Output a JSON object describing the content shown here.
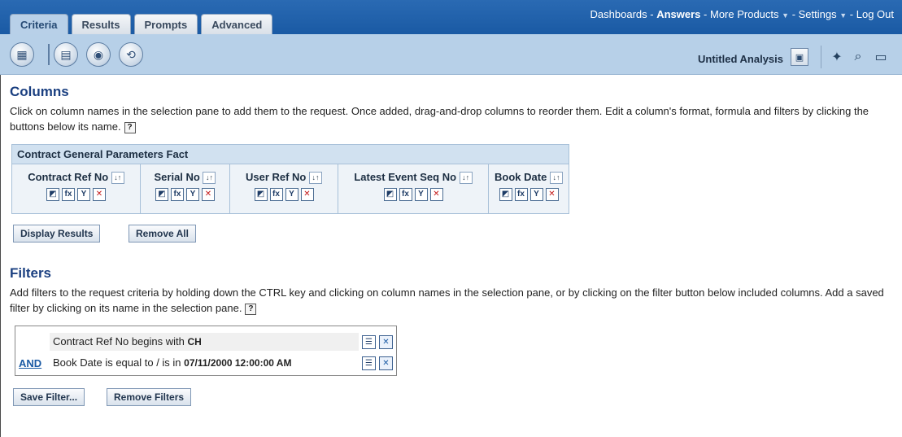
{
  "tabs": [
    {
      "label": "Criteria"
    },
    {
      "label": "Results"
    },
    {
      "label": "Prompts"
    },
    {
      "label": "Advanced"
    }
  ],
  "global_nav": {
    "dashboards": "Dashboards",
    "answers": "Answers",
    "more_products": "More Products",
    "settings": "Settings",
    "logout": "Log Out",
    "separator": " - "
  },
  "toolbar": {
    "analysis_title": "Untitled Analysis",
    "icons": [
      "chart-icon",
      "table-view-icon",
      "disk-icon",
      "refresh-icon",
      "preview-icon",
      "new-icon",
      "open-icon",
      "save-icon"
    ]
  },
  "columns": {
    "title": "Columns",
    "description": "Click on column names in the selection pane to add them to the request. Once added, drag-and-drop columns to reorder them. Edit a column's format, formula and filters by clicking the buttons below its name.",
    "table_header": "Contract General Parameters Fact",
    "items": [
      {
        "name": "Contract Ref No"
      },
      {
        "name": "Serial No"
      },
      {
        "name": "User Ref No"
      },
      {
        "name": "Latest Event Seq No"
      },
      {
        "name": "Book Date"
      }
    ],
    "display_results": "Display Results",
    "remove_all": "Remove All"
  },
  "filters": {
    "title": "Filters",
    "description": "Add filters to the request criteria by holding down the CTRL key and clicking on column names in the selection pane, or by clicking on the filter button below included columns. Add a saved filter by clicking on its name in the selection pane.",
    "rows": [
      {
        "operator": "",
        "text": "Contract Ref No begins with ",
        "value": "CH"
      },
      {
        "operator": "AND",
        "text": "Book Date is equal to / is in ",
        "value": "07/11/2000 12:00:00 AM"
      }
    ],
    "save_filter": "Save Filter...",
    "remove_filters": "Remove Filters"
  }
}
